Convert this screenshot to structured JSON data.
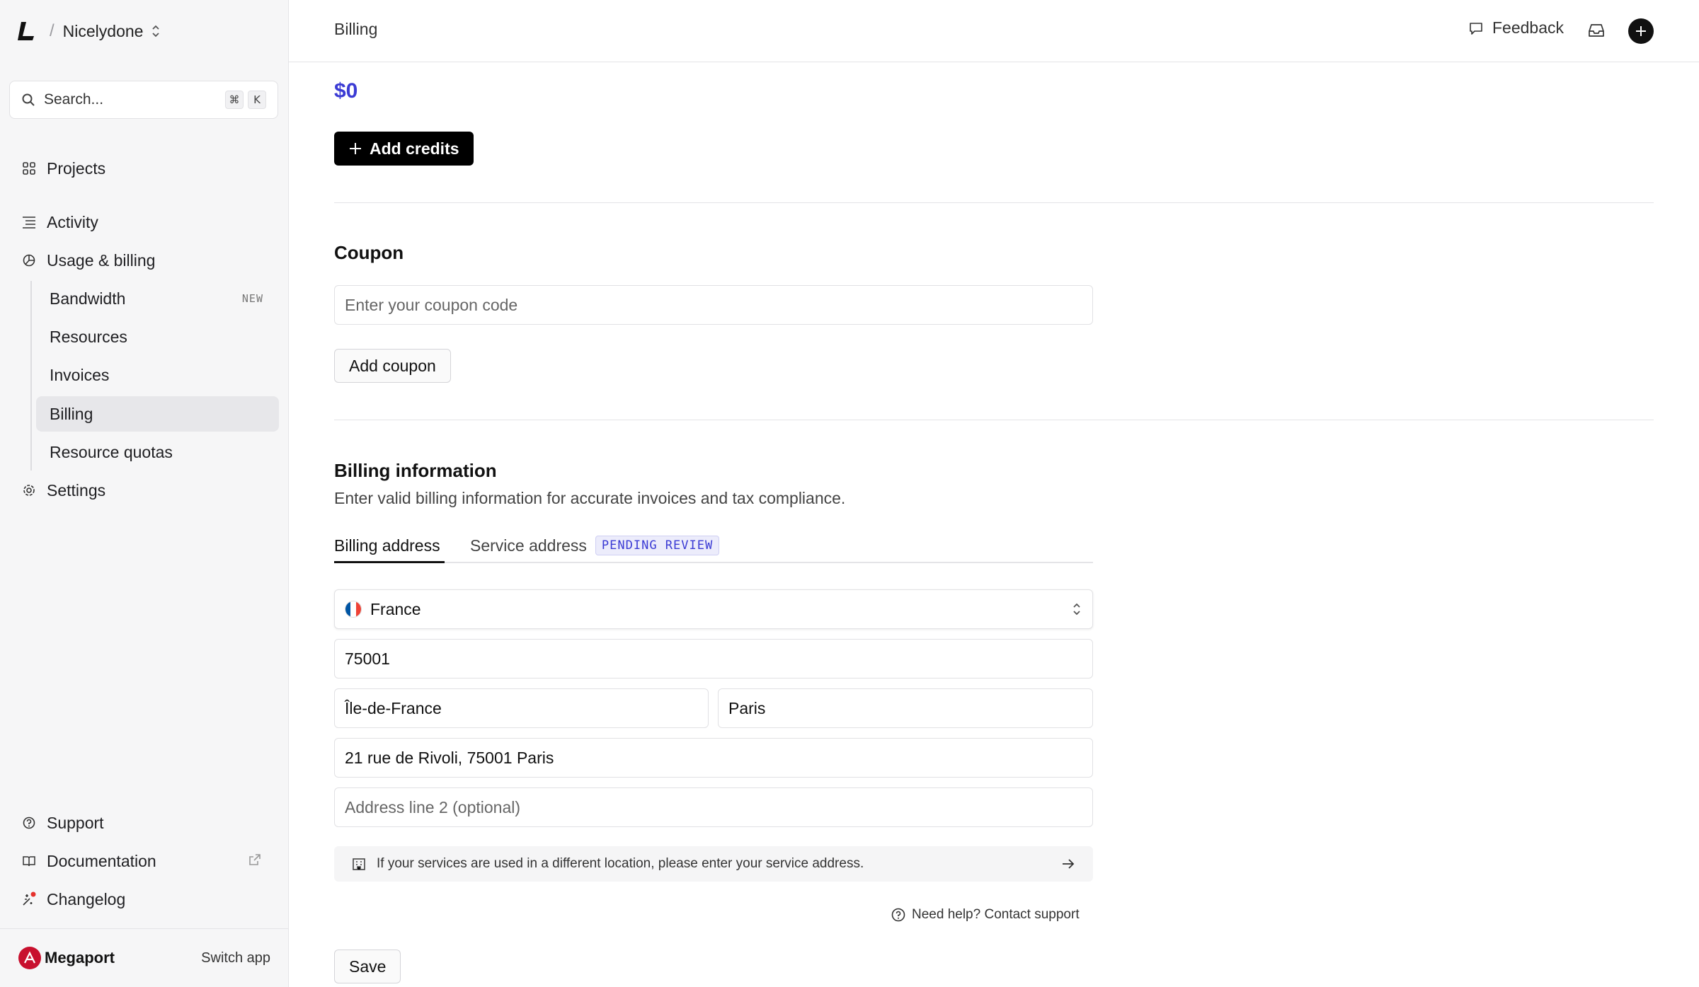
{
  "sidebar": {
    "org_name": "Nicelydone",
    "search_placeholder": "Search...",
    "search_kbd": [
      "⌘",
      "K"
    ],
    "nav": {
      "projects": "Projects",
      "activity": "Activity",
      "usage_billing": "Usage & billing",
      "settings": "Settings",
      "support": "Support",
      "documentation": "Documentation",
      "changelog": "Changelog"
    },
    "sub_items": [
      {
        "label": "Bandwidth",
        "badge": "NEW"
      },
      {
        "label": "Resources"
      },
      {
        "label": "Invoices"
      },
      {
        "label": "Billing",
        "active": true
      },
      {
        "label": "Resource quotas"
      }
    ],
    "footer": {
      "brand": "Megaport",
      "switch_app": "Switch app"
    }
  },
  "header": {
    "breadcrumb": "Billing",
    "feedback": "Feedback"
  },
  "credits": {
    "amount": "$0",
    "add_credits_label": "Add credits"
  },
  "coupon": {
    "title": "Coupon",
    "placeholder": "Enter your coupon code",
    "button": "Add coupon"
  },
  "billing_info": {
    "title": "Billing information",
    "description": "Enter valid billing information for accurate invoices and tax compliance.",
    "tabs": {
      "billing_address": "Billing address",
      "service_address": "Service address",
      "pending_badge": "PENDING REVIEW"
    },
    "country": "France",
    "postal_code": "75001",
    "region": "Île-de-France",
    "city": "Paris",
    "address_line1": "21 rue de Rivoli, 75001 Paris",
    "address_line2_placeholder": "Address line 2 (optional)",
    "notice": "If your services are used in a different location, please enter your service address.",
    "help": "Need help? Contact support",
    "save": "Save"
  },
  "colors": {
    "accent": "#3b3bd4",
    "brand_red": "#c8102e",
    "france_blue": "#0055a4",
    "france_red": "#ef4135"
  }
}
